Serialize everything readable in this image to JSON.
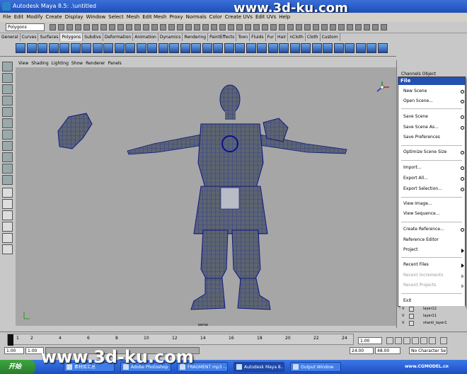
{
  "window": {
    "title": "Autodesk Maya 8.5: .\\untitled"
  },
  "watermark": {
    "top": "www.3d-ku.com",
    "bottom": "www.3d-ku.com",
    "corner": "www.CGMODEL.cn"
  },
  "menubar": [
    "File",
    "Edit",
    "Modify",
    "Create",
    "Display",
    "Window",
    "Select",
    "Mesh",
    "Edit Mesh",
    "Proxy",
    "Normals",
    "Color",
    "Create UVs",
    "Edit UVs",
    "Help"
  ],
  "mode_selector": "Polygons",
  "shelf_tabs": [
    "General",
    "Curves",
    "Surfaces",
    "Polygons",
    "Subdivs",
    "Deformation",
    "Animation",
    "Dynamics",
    "Rendering",
    "PaintEffects",
    "Toon",
    "Fluids",
    "Fur",
    "Hair",
    "nCloth",
    "Cloth",
    "Custom"
  ],
  "active_shelf": "Polygons",
  "panel_menu": [
    "View",
    "Shading",
    "Lighting",
    "Show",
    "Renderer",
    "Panels"
  ],
  "viewport": {
    "camera_label": "persp",
    "axis_labels": [
      "y",
      "x",
      "z"
    ]
  },
  "channel_box": {
    "title": "Channels Object"
  },
  "file_menu": {
    "title": "File",
    "items": [
      {
        "label": "New Scene",
        "type": "option"
      },
      {
        "label": "Open Scene...",
        "type": "option"
      },
      {
        "label": "Save Scene",
        "type": "option"
      },
      {
        "label": "Save Scene As...",
        "type": "option"
      },
      {
        "label": "Save Preferences",
        "type": "plain"
      },
      {
        "label": "Optimize Scene Size",
        "type": "option"
      },
      {
        "label": "Import...",
        "type": "option"
      },
      {
        "label": "Export All...",
        "type": "option"
      },
      {
        "label": "Export Selection...",
        "type": "option"
      },
      {
        "label": "View Image...",
        "type": "plain"
      },
      {
        "label": "View Sequence...",
        "type": "plain"
      },
      {
        "label": "Create Reference...",
        "type": "option"
      },
      {
        "label": "Reference Editor",
        "type": "plain"
      },
      {
        "label": "Project",
        "type": "submenu"
      },
      {
        "label": "Recent Files",
        "type": "submenu"
      },
      {
        "label": "Recent Increments",
        "type": "disabled-submenu"
      },
      {
        "label": "Recent Projects",
        "type": "disabled-submenu"
      },
      {
        "label": "Exit",
        "type": "plain"
      }
    ]
  },
  "layers": [
    {
      "v": "V",
      "name": "layer12"
    },
    {
      "v": "V",
      "name": "layer11"
    },
    {
      "v": "V",
      "name": "shanti_layer1"
    }
  ],
  "timeline": {
    "ticks": [
      "1",
      "2",
      "4",
      "6",
      "8",
      "10",
      "12",
      "14",
      "16",
      "18",
      "20",
      "22",
      "24"
    ],
    "current_frame": "1.00"
  },
  "range": {
    "start": "1.00",
    "start2": "1.00",
    "end_slider": "24",
    "end": "24.00",
    "end2": "48.00",
    "character_set": "No Character Se"
  },
  "taskbar": {
    "start": "开始",
    "buttons": [
      "素材库汇总",
      "Adobe Photoshop",
      "FRAGMENT mp3 -...",
      "Autodesk Maya 8...",
      "Output Window"
    ],
    "active": "Autodesk Maya 8..."
  },
  "colors": {
    "title_bar": "#2456c8",
    "viewport": "#a6a6a6",
    "mesh": "#5c6470",
    "wire": "#1a2aa0",
    "menu_header": "#2450b0"
  }
}
